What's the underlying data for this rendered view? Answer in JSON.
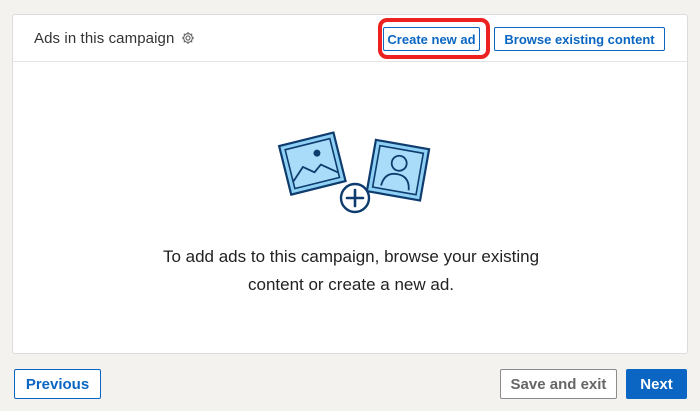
{
  "campaign": {
    "title": "Ads in this campaign",
    "settings_icon": "gear-icon",
    "create_label": "Create new ad",
    "browse_label": "Browse existing content"
  },
  "empty_state": {
    "illustration_icon": "add-media-illustration",
    "line1": "To add ads to this campaign, browse your existing",
    "line2": "content or create a new ad."
  },
  "footer": {
    "previous_label": "Previous",
    "save_exit_label": "Save and exit",
    "next_label": "Next"
  },
  "colors": {
    "brand_blue": "#0a66c2",
    "highlight_red": "#ee2121",
    "illustration_blue": "#8fd0f5"
  }
}
